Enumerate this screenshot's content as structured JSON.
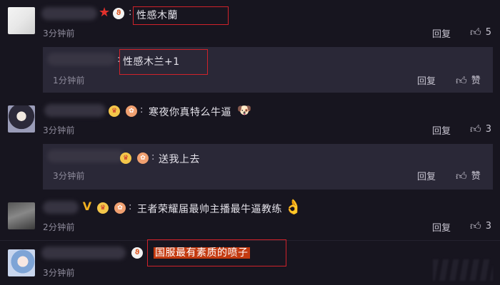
{
  "comments": [
    {
      "text": "性感木蘭",
      "time": "3分钟前",
      "reply_label": "回复",
      "likes": "5",
      "emoji": ""
    },
    {
      "text": "寒夜你真特么牛逼",
      "time": "3分钟前",
      "reply_label": "回复",
      "likes": "3",
      "emoji": "🐶"
    },
    {
      "text": "王者荣耀届最帅主播最牛逼教练",
      "time": "2分钟前",
      "reply_label": "回复",
      "likes": "3",
      "emoji": "👌"
    },
    {
      "text": "国服最有素质的喷子",
      "time": "3分钟前",
      "reply_label": "",
      "likes": "",
      "emoji": ""
    }
  ],
  "replies": [
    {
      "text": "性感木兰+1",
      "time": "1分钟前",
      "reply_label": "回复",
      "like_label": "赞"
    },
    {
      "text": "送我上去",
      "time": "3分钟前",
      "reply_label": "回复",
      "like_label": "赞"
    }
  ],
  "separator": ":",
  "icons": {
    "like": "thumbs-up-icon",
    "star": "star-icon",
    "swirl": "swirl-badge-icon",
    "crown": "crown-badge-icon",
    "medal": "medal-badge-icon"
  },
  "colors": {
    "background": "#17151f",
    "reply_background": "#2a2837",
    "highlight_border": "#d0222a",
    "highlight_fill": "#c33a10"
  }
}
